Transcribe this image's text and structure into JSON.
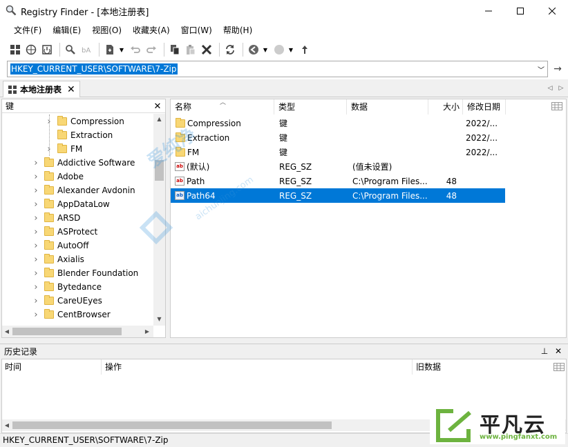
{
  "window": {
    "title": "Registry Finder - [本地注册表]"
  },
  "menu": [
    "文件(F)",
    "编辑(E)",
    "视图(O)",
    "收藏夹(A)",
    "窗口(W)",
    "帮助(H)"
  ],
  "address": {
    "value": "HKEY_CURRENT_USER\\SOFTWARE\\7-Zip"
  },
  "tab": {
    "label": "本地注册表"
  },
  "tree": {
    "header": "键",
    "items": [
      {
        "label": "Compression",
        "expandable": true,
        "level": 2
      },
      {
        "label": "Extraction",
        "expandable": false,
        "level": 2
      },
      {
        "label": "FM",
        "expandable": true,
        "level": 2
      },
      {
        "label": "Addictive Software",
        "expandable": true,
        "level": 1
      },
      {
        "label": "Adobe",
        "expandable": true,
        "level": 1
      },
      {
        "label": "Alexander Avdonin",
        "expandable": true,
        "level": 1
      },
      {
        "label": "AppDataLow",
        "expandable": true,
        "level": 1
      },
      {
        "label": "ARSD",
        "expandable": true,
        "level": 1
      },
      {
        "label": "ASProtect",
        "expandable": true,
        "level": 1
      },
      {
        "label": "AutoOff",
        "expandable": true,
        "level": 1
      },
      {
        "label": "Axialis",
        "expandable": true,
        "level": 1
      },
      {
        "label": "Blender Foundation",
        "expandable": true,
        "level": 1
      },
      {
        "label": "Bytedance",
        "expandable": true,
        "level": 1
      },
      {
        "label": "CareUEyes",
        "expandable": true,
        "level": 1
      },
      {
        "label": "CentBrowser",
        "expandable": true,
        "level": 1
      }
    ]
  },
  "list": {
    "columns": {
      "name": "名称",
      "type": "类型",
      "data": "数据",
      "size": "大小",
      "date": "修改日期"
    },
    "rows": [
      {
        "icon": "folder",
        "name": "Compression",
        "type": "键",
        "data": "",
        "size": "",
        "date": "2022/..."
      },
      {
        "icon": "folder",
        "name": "Extraction",
        "type": "键",
        "data": "",
        "size": "",
        "date": "2022/..."
      },
      {
        "icon": "folder",
        "name": "FM",
        "type": "键",
        "data": "",
        "size": "",
        "date": "2022/..."
      },
      {
        "icon": "string",
        "name": "(默认)",
        "type": "REG_SZ",
        "data": "(值未设置)",
        "size": "",
        "date": ""
      },
      {
        "icon": "string",
        "name": "Path",
        "type": "REG_SZ",
        "data": "C:\\Program Files...",
        "size": "48",
        "date": ""
      },
      {
        "icon": "string",
        "name": "Path64",
        "type": "REG_SZ",
        "data": "C:\\Program Files...",
        "size": "48",
        "date": "",
        "selected": true
      }
    ]
  },
  "history": {
    "title": "历史记录",
    "columns": {
      "time": "时间",
      "action": "操作",
      "old": "旧数据"
    }
  },
  "status": {
    "text": "HKEY_CURRENT_USER\\SOFTWARE\\7-Zip"
  },
  "watermark": {
    "center": "爱纯净",
    "center_url": "aichunjing.com",
    "logo_text": "平凡云",
    "logo_url": "www.pingfanxt.com"
  },
  "colors": {
    "accent": "#0078d7",
    "folder": "#f8d775"
  }
}
